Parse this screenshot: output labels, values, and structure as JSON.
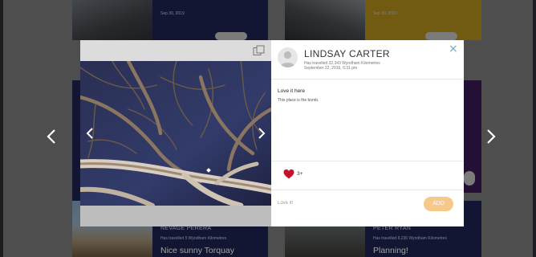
{
  "feed": {
    "top_left_date": "Sep 30, 2019",
    "top_right_date": "Sep 30, 2019",
    "bottom_left": {
      "name": "NEVAGE PERERA",
      "meta": "Has travelled 5 Wyndham Kilometres",
      "title": "Nice sunny Torquay"
    },
    "bottom_right": {
      "name": "PETER RYAN",
      "meta": "Has travelled 8,236 Wyndham Kilometres",
      "title": "Planning!"
    }
  },
  "icons": {
    "prev_page": "chevron-left-icon",
    "next_page": "chevron-right-icon",
    "prev_photo": "chevron-left-icon",
    "next_photo": "chevron-right-icon",
    "close": "close-icon",
    "copy": "copy-icon",
    "like": "heart-icon",
    "avatar": "user-avatar-icon"
  },
  "modal": {
    "user_name": "LINDSAY CARTER",
    "travelled": "Has travelled 32,343 Wyndham Kilometres",
    "posted_at": "September 22, 2016, 6:31 pm",
    "close_label": "×",
    "post_title": "Love it here",
    "post_body": "This place is the bomb.",
    "likes": "3+",
    "comment_placeholder": "Love it!",
    "add_label": "ADD"
  },
  "colors": {
    "navy_card": "#202552",
    "gold_card": "#b6931e",
    "purple_card": "#3b1b54",
    "like_heart": "#c8102e",
    "add_button": "#f7c88b",
    "close_icon": "#6aa8c9"
  }
}
